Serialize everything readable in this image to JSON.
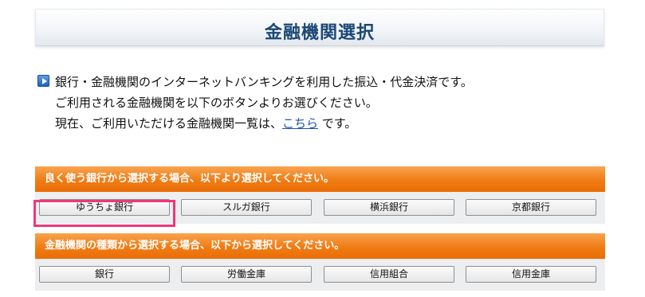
{
  "header": {
    "title": "金融機関選択"
  },
  "intro": {
    "line1": "銀行・金融機関のインターネットバンキングを利用した振込・代金決済です。",
    "line2": "ご利用される金融機関を以下のボタンよりお選びください。",
    "line3_prefix": "現在、ご利用いただける金融機関一覧は、",
    "line3_link": "こちら",
    "line3_suffix": " です。"
  },
  "frequent_section": {
    "header": "良く使う銀行から選択する場合、以下より選択してください。",
    "buttons": [
      "ゆうちょ銀行",
      "スルガ銀行",
      "横浜銀行",
      "京都銀行"
    ]
  },
  "type_section": {
    "header": "金融機関の種類から選択する場合、以下から選択してください。",
    "buttons": [
      "銀行",
      "労働金庫",
      "信用組合",
      "信用金庫"
    ]
  },
  "colors": {
    "title_text": "#1a4775",
    "section_header": "#f07c14",
    "highlight_border": "#f0367c",
    "link": "#1a55b0"
  }
}
